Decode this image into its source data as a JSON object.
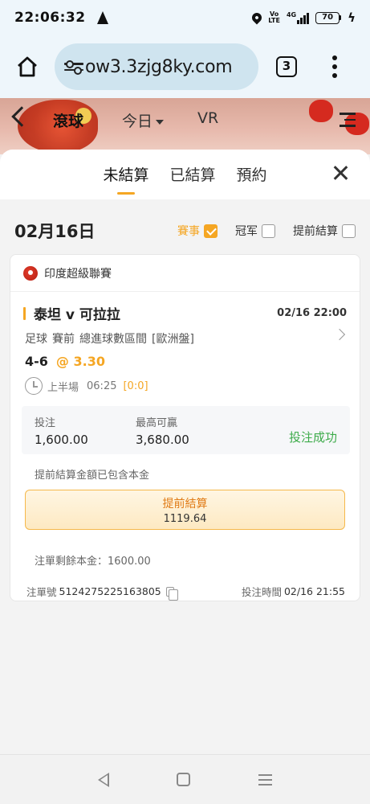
{
  "status_bar": {
    "time": "22:06:32",
    "volte": "Vo LTE",
    "network": "4G",
    "battery": "70"
  },
  "browser": {
    "url": "ow3.3zjg8ky.com",
    "tab_count": "3"
  },
  "header": {
    "tabs": [
      "滾球",
      "今日",
      "VR"
    ]
  },
  "sheet": {
    "tabs": [
      "未結算",
      "已結算",
      "預約"
    ],
    "date": "02月16日",
    "filters": [
      {
        "label": "賽事",
        "checked": true
      },
      {
        "label": "冠军",
        "checked": false
      },
      {
        "label": "提前結算",
        "checked": false
      }
    ]
  },
  "bet": {
    "league": "印度超級聯賽",
    "match": "泰坦 v 可拉拉",
    "match_time": "02/16 22:00",
    "market": [
      "足球",
      "賽前",
      "總進球數區間",
      "[歐洲盤]"
    ],
    "pick": "4-6",
    "odds": "@ 3.30",
    "period": "上半場",
    "clock": "06:25",
    "score": "[0:0]",
    "stake_label": "投注",
    "stake": "1,600.00",
    "max_win_label": "最高可贏",
    "max_win": "3,680.00",
    "status": "投注成功",
    "cashout_note": "提前結算金額已包含本金",
    "cashout_label": "提前結算",
    "cashout_amount": "1119.64",
    "remaining": "注單剩餘本金：1600.00",
    "bet_id_label": "注單號",
    "bet_id": "5124275225163805",
    "bet_time_label": "投注時間",
    "bet_time": "02/16 21:55"
  },
  "colors": {
    "accent": "#f5a623",
    "success": "#3dab4a"
  }
}
